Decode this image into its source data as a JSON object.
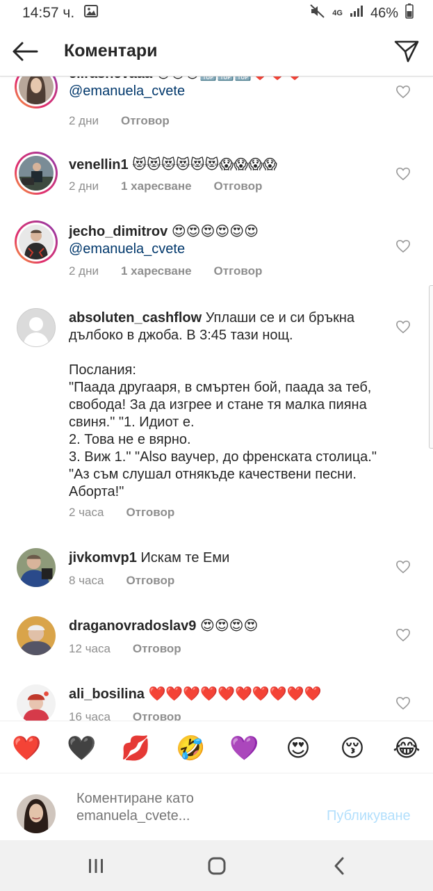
{
  "status_bar": {
    "time": "14:57 ч.",
    "network": "4G",
    "battery": "46%"
  },
  "header": {
    "title": "Коментари"
  },
  "comments": [
    {
      "username": "ellrasnevaaa",
      "text": " 😻😻😻🔝🔝🔝❤️❤️❤️",
      "mention": "@emanuela_cvete",
      "time": "2 дни",
      "likes": "",
      "reply": "Отговор"
    },
    {
      "username": "venellin1",
      "text": " 😻😻😻😻😻😻😱😱😱😱",
      "mention": "",
      "time": "2 дни",
      "likes": "1 харесване",
      "reply": "Отговор"
    },
    {
      "username": "jecho_dimitrov",
      "text": " 😍😍😍😍😍😍",
      "mention": "@emanuela_cvete",
      "time": "2 дни",
      "likes": "1 харесване",
      "reply": "Отговор"
    },
    {
      "username": "absoluten_cashflow",
      "text": " Уплаши се и си бръкна дълбоко в джоба. В 3:45 тази нощ.\n\nПослания:\n\"Паада другааря, в смъртен бой, паада за теб, свобода! За да изгрее и стане тя малка пияна свиня.\" \"1. Идиот е.\n2. Това не е вярно.\n3. Виж 1.\" \"Also ваучер, до френската столица.\" \"Аз съм слушал отнякъде качествени песни. Аборта!\"",
      "mention": "",
      "time": "2 часа",
      "likes": "",
      "reply": "Отговор"
    },
    {
      "username": "jivkomvp1",
      "text": " Искам те Еми",
      "mention": "",
      "time": "8 часа",
      "likes": "",
      "reply": "Отговор"
    },
    {
      "username": "draganovradoslav9",
      "text": " 😍😍😍😍",
      "mention": "",
      "time": "12 часа",
      "likes": "",
      "reply": "Отговор"
    },
    {
      "username": "ali_bosilina",
      "text": " ❤️❤️❤️❤️❤️❤️❤️❤️❤️❤️",
      "mention": "",
      "time": "16 часа",
      "likes": "",
      "reply": "Отговор"
    }
  ],
  "emoji_bar": [
    "❤️",
    "🖤",
    "💋",
    "🤣",
    "💜",
    "😍",
    "😚",
    "😂"
  ],
  "comment_input": {
    "placeholder": "Коментиране като emanuela_cvete...",
    "publish_label": "Публикуване"
  },
  "colors": {
    "mention": "#00376b",
    "meta": "#8e8e8e",
    "publish_disabled": "#b2dffc"
  }
}
